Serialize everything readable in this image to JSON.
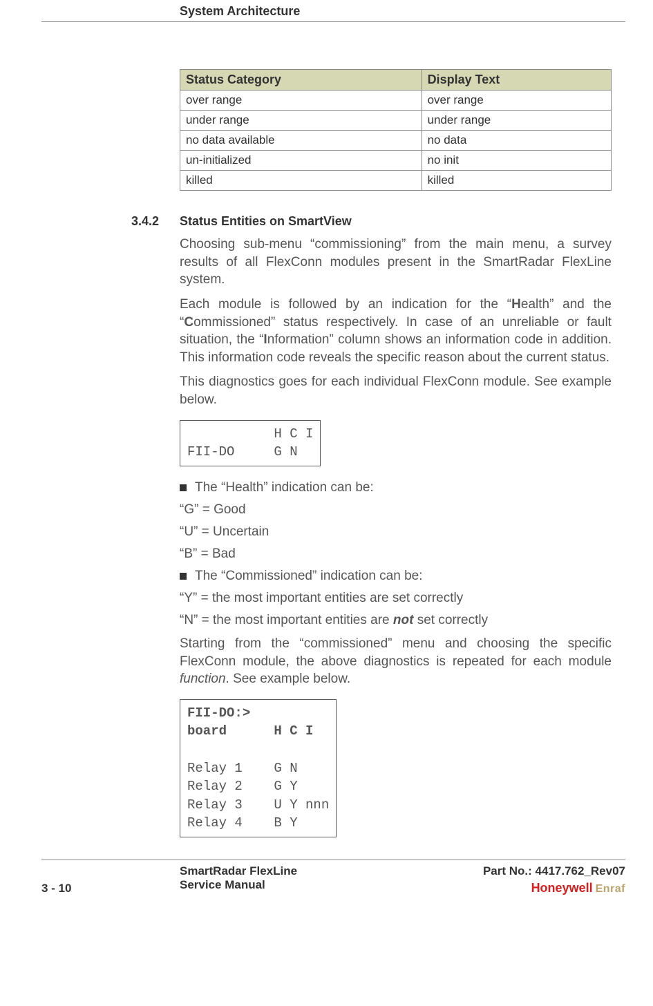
{
  "header": {
    "title": "System Architecture"
  },
  "table": {
    "headers": [
      "Status Category",
      "Display Text"
    ],
    "rows": [
      [
        "over range",
        "over range"
      ],
      [
        "under range",
        "under range"
      ],
      [
        "no data available",
        "no data"
      ],
      [
        "un-initialized",
        "no init"
      ],
      [
        "killed",
        "killed"
      ]
    ]
  },
  "section": {
    "number": "3.4.2",
    "title": "Status Entities on SmartView"
  },
  "para1": "Choosing sub-menu “commissioning” from the main menu, a survey results of all FlexConn modules present in the SmartRadar FlexLine system.",
  "para2": {
    "s1": "Each module is followed by an indication for the “",
    "b1": "H",
    "s2": "ealth” and the “",
    "b2": "C",
    "s3": "ommissioned” status respectively. In case of an unreliable or fault situation, the “",
    "b3": "I",
    "s4": "nformation” column shows an information code in addition. This information code reveals the specific reason about the current status."
  },
  "para3": "This diagnostics goes for each individual FlexConn module. See example below.",
  "code1": "           H C I\nFII-DO     G N",
  "bullet1": "The “Health” indication can be:",
  "health": {
    "g": "“G” = Good",
    "u": "“U” = Uncertain",
    "b": "“B” = Bad"
  },
  "bullet2": "The “Commissioned” indication can be:",
  "comm": {
    "y": "“Y” = the most important entities are set correctly",
    "n_pre": "“N” = the most important entities are ",
    "n_em": "not",
    "n_post": " set correctly"
  },
  "para4": {
    "pre": "Starting from the “commissioned” menu and choosing the specific FlexConn module, the above diagnostics is repeated for each module ",
    "em": "function",
    "post": ". See example below."
  },
  "code2": {
    "l1": "FII-DO:>",
    "l2": "board      H C I",
    "l3": "",
    "l4": "Relay 1    G N",
    "l5": "Relay 2    G Y",
    "l6": "Relay 3    U Y nnn",
    "l7": "Relay 4    B Y"
  },
  "footer": {
    "page": "3 - 10",
    "mid1": "SmartRadar FlexLine",
    "mid2": "Service Manual",
    "right": "Part No.: 4417.762_Rev07",
    "brand1": "Honeywell",
    "brand2": "Enraf"
  }
}
